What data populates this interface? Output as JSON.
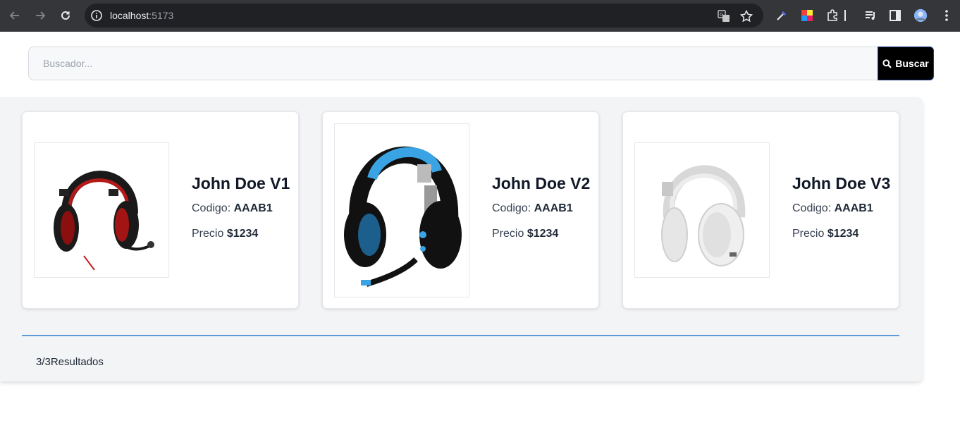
{
  "browser": {
    "url_host": "localhost",
    "url_port": ":5173"
  },
  "search": {
    "placeholder": "Buscador...",
    "value": "",
    "button_label": "Buscar"
  },
  "products": [
    {
      "name": "John Doe V1",
      "code_label": "Codigo:",
      "code": "AAAB1",
      "price_label": "Precio",
      "price": "$1234",
      "image": "red-black-headset"
    },
    {
      "name": "John Doe V2",
      "code_label": "Codigo:",
      "code": "AAAB1",
      "price_label": "Precio",
      "price": "$1234",
      "image": "blue-black-gaming-headset"
    },
    {
      "name": "John Doe V3",
      "code_label": "Codigo:",
      "code": "AAAB1",
      "price_label": "Precio",
      "price": "$1234",
      "image": "white-headphones"
    }
  ],
  "results_count": "3/3Resultados",
  "colors": {
    "button_bg": "#000000",
    "panel_bg": "#f3f4f6",
    "divider": "#5b9bd5"
  }
}
